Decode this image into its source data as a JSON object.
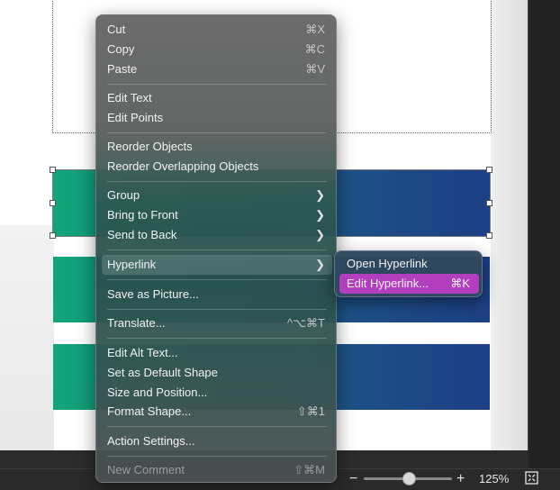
{
  "menu": {
    "cut": {
      "label": "Cut",
      "shortcut": "⌘X"
    },
    "copy": {
      "label": "Copy",
      "shortcut": "⌘C"
    },
    "paste": {
      "label": "Paste",
      "shortcut": "⌘V"
    },
    "edit_text": {
      "label": "Edit Text"
    },
    "edit_points": {
      "label": "Edit Points"
    },
    "reorder_objects": {
      "label": "Reorder Objects"
    },
    "reorder_overlapping": {
      "label": "Reorder Overlapping Objects"
    },
    "group": {
      "label": "Group",
      "submenu_icon": "chevron-right-icon"
    },
    "bring_to_front": {
      "label": "Bring to Front",
      "submenu_icon": "chevron-right-icon"
    },
    "send_to_back": {
      "label": "Send to Back",
      "submenu_icon": "chevron-right-icon"
    },
    "hyperlink": {
      "label": "Hyperlink",
      "submenu_icon": "chevron-right-icon"
    },
    "save_as_picture": {
      "label": "Save as Picture..."
    },
    "translate": {
      "label": "Translate...",
      "shortcut": "^⌥⌘T"
    },
    "edit_alt_text": {
      "label": "Edit Alt Text..."
    },
    "set_default_shape": {
      "label": "Set as Default Shape"
    },
    "size_and_position": {
      "label": "Size and Position..."
    },
    "format_shape": {
      "label": "Format Shape...",
      "shortcut": "⇧⌘1"
    },
    "action_settings": {
      "label": "Action Settings..."
    },
    "new_comment": {
      "label": "New Comment",
      "shortcut": "⇧⌘M",
      "disabled": true
    }
  },
  "submenu": {
    "open_hyperlink": {
      "label": "Open Hyperlink"
    },
    "edit_hyperlink": {
      "label": "Edit Hyperlink...",
      "shortcut": "⌘K"
    }
  },
  "statusbar": {
    "zoom_minus": "−",
    "zoom_plus": "+",
    "zoom_level": "125%",
    "zoom_fraction": 0.52,
    "fit_icon": "fit-to-window-icon"
  },
  "colors": {
    "selection_highlight": "#b23fbd",
    "bar_start": "#12a67b",
    "bar_end": "#1d3f86"
  }
}
